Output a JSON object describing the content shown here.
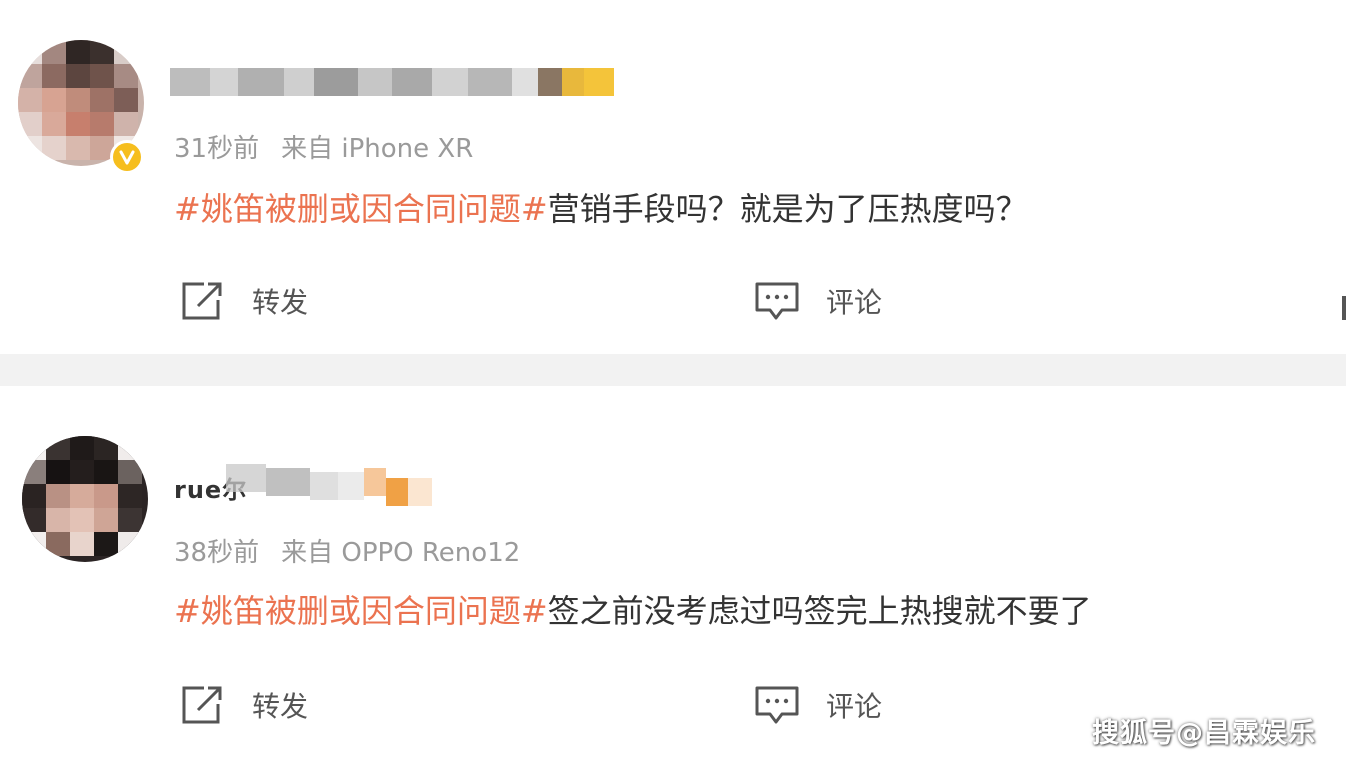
{
  "posts": [
    {
      "username": "",
      "time": "31秒前",
      "source": "来自 iPhone XR",
      "hashtag": "#姚笛被删或因合同问题#",
      "text": "营销手段吗？就是为了压热度吗？",
      "repost_label": "转发",
      "comment_label": "评论",
      "avatar_icon": "pixelated-avatar",
      "badge_icon": "verified-badge-icon"
    },
    {
      "username": "rue尔",
      "time": "38秒前",
      "source": "来自 OPPO Reno12",
      "hashtag": "#姚笛被删或因合同问题#",
      "text": "签之前没考虑过吗签完上热搜就不要了",
      "repost_label": "转发",
      "comment_label": "评论",
      "avatar_icon": "pixelated-avatar"
    }
  ],
  "watermark": "搜狐号@昌霖娱乐",
  "colors": {
    "hashtag": "#eb7350",
    "body_text": "#333333",
    "meta_text": "#9a9a9a",
    "divider": "#f2f2f2",
    "badge": "#f6be1e"
  }
}
